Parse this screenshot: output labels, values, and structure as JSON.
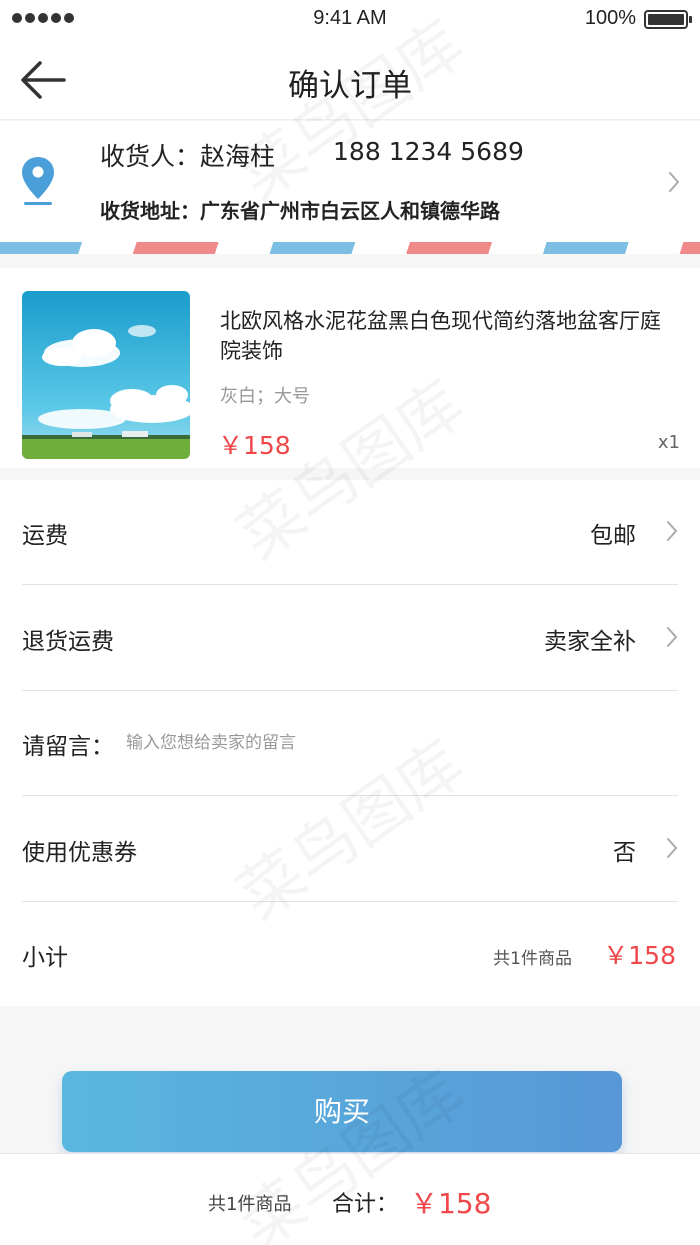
{
  "status_bar": {
    "time": "9:41 AM",
    "battery": "100%"
  },
  "nav": {
    "title": "确认订单"
  },
  "address": {
    "receiver_label": "收货人：",
    "receiver_name": "赵海柱",
    "phone": "188 1234 5689",
    "address_label": "收货地址：",
    "address": "广东省广州市白云区人和镇德华路"
  },
  "product": {
    "title": "北欧风格水泥花盆黑白色现代简约落地盆客厅庭院装饰",
    "spec": "灰白；大号",
    "price": "￥158",
    "quantity": "x1"
  },
  "rows": {
    "shipping": {
      "label": "运费",
      "value": "包邮"
    },
    "return_shipping": {
      "label": "退货运费",
      "value": "卖家全补"
    },
    "message": {
      "label": "请留言：",
      "placeholder": "输入您想给卖家的留言",
      "value": ""
    },
    "coupon": {
      "label": "使用优惠券",
      "value": "否"
    },
    "subtotal": {
      "label": "小计",
      "count": "共1件商品",
      "price": "￥158"
    }
  },
  "buy_button": {
    "label": "购买"
  },
  "footer": {
    "count": "共1件商品",
    "total_label": "合计：",
    "total_price": "￥158"
  },
  "watermark": {
    "text": "菜鸟图库"
  },
  "colors": {
    "accent_red": "#f0484a",
    "button_blue_start": "#5ab7de",
    "button_blue_end": "#5797d8",
    "pin_blue": "#4a9fd8"
  },
  "icons": {
    "back": "arrow-left-icon",
    "location": "location-pin-icon",
    "chevron": "chevron-right-icon"
  }
}
